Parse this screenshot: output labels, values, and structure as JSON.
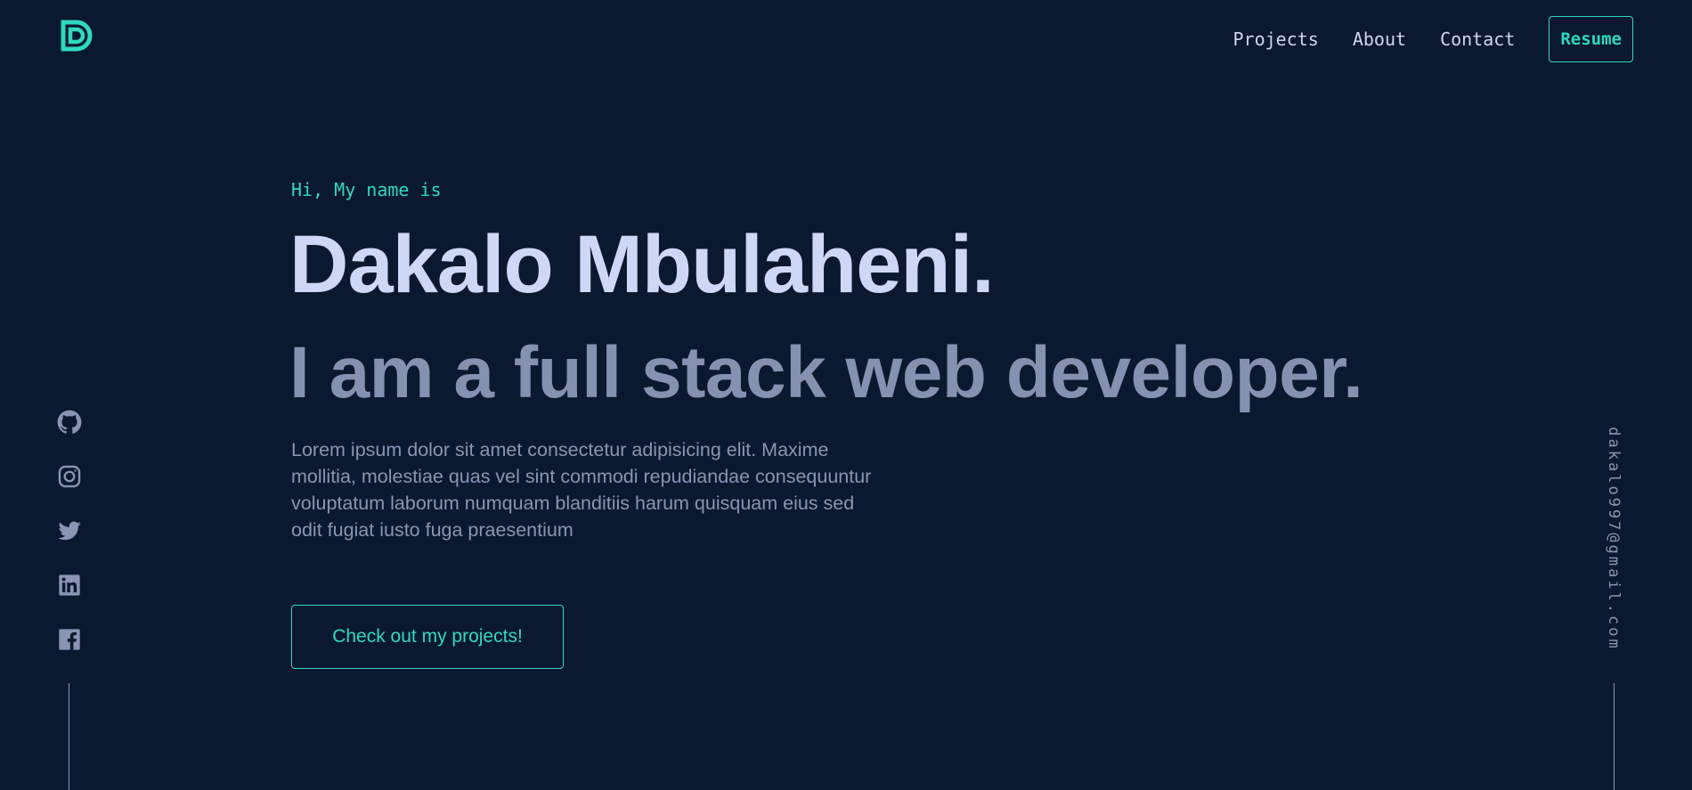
{
  "header": {
    "logo_icon": "d-monogram-icon",
    "nav": [
      {
        "label": "Projects"
      },
      {
        "label": "About"
      },
      {
        "label": "Contact"
      }
    ],
    "resume_label": "Resume"
  },
  "hero": {
    "greeting": "Hi, My name is",
    "name": "Dakalo Mbulaheni.",
    "tagline": "I am a full stack web developer.",
    "bio": "Lorem ipsum dolor sit amet consectetur adipisicing elit. Maxime mollitia, molestiae quas vel sint commodi repudiandae consequuntur voluptatum laborum numquam blanditiis harum quisquam eius sed odit fugiat iusto fuga praesentium",
    "cta_label": "Check out my projects!"
  },
  "socials": [
    "github-icon",
    "instagram-icon",
    "twitter-icon",
    "linkedin-icon",
    "facebook-icon"
  ],
  "email": "dakalo997@gmail.com",
  "colors": {
    "background": "#0b1930",
    "accent": "#2fd8c0",
    "heading": "#cfd7f7",
    "muted": "#8a94b4"
  }
}
